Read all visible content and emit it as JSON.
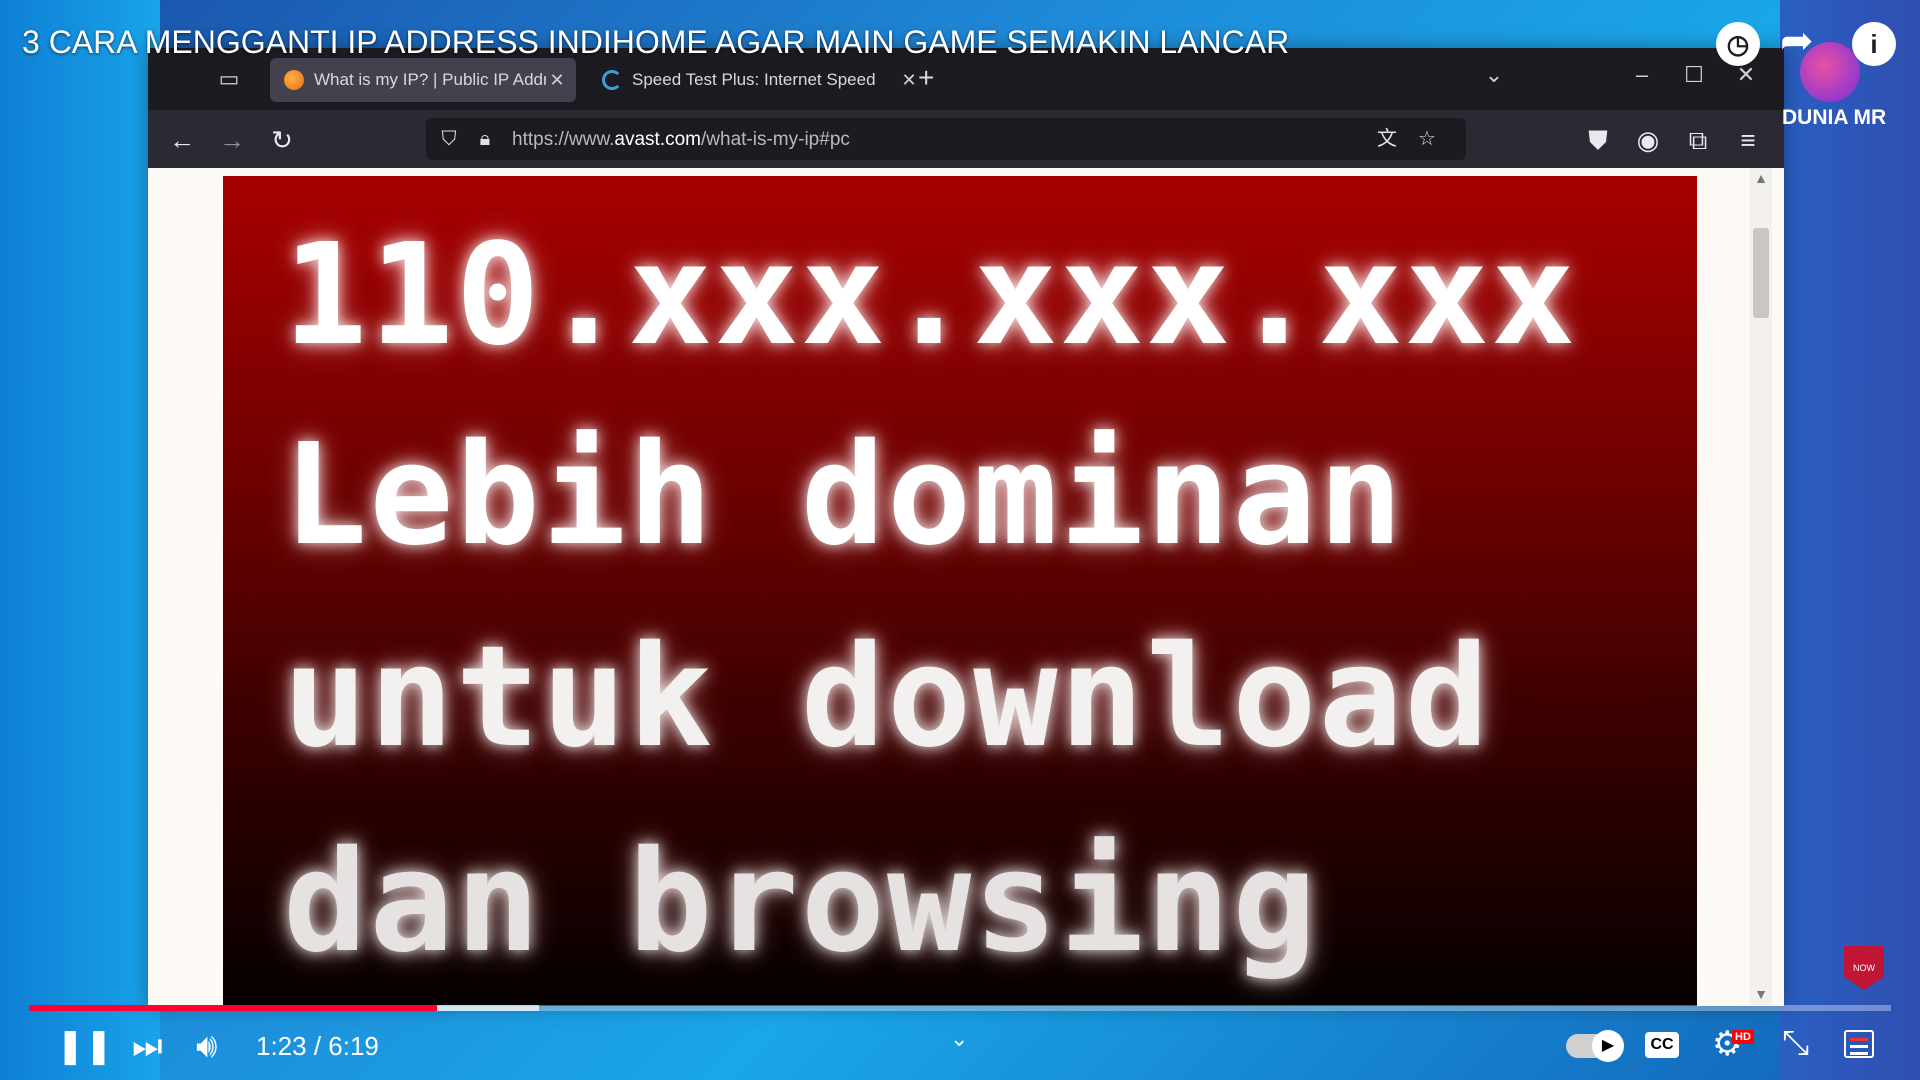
{
  "video": {
    "title": "3 CARA MENGGANTI IP ADDRESS INDIHOME AGAR MAIN GAME SEMAKIN LANCAR",
    "channel_name": "DUNIA MR",
    "current_time": "1:23",
    "duration": "6:19",
    "time_display": "1:23 / 6:19",
    "progress_played_fraction": 0.219,
    "progress_buffered_fraction": 0.274,
    "hd_badge": "HD",
    "cc_label": "CC",
    "subscribe_badge_text": "NOW"
  },
  "browser": {
    "tabs": [
      {
        "title": "What is my IP? | Public IP Addre",
        "active": true
      },
      {
        "title": "Speed Test Plus: Internet Speed",
        "active": false
      }
    ],
    "url_prefix": "https://www.",
    "url_host": "avast.com",
    "url_path": "/what-is-my-ip#pc"
  },
  "overlay": {
    "line1": "110.xxx.xxx.xxx",
    "line2": "Lebih dominan",
    "line3": "untuk download",
    "line4": "dan browsing"
  },
  "icons": {
    "watch_later": "clock-icon",
    "share": "share-icon",
    "info": "info-icon",
    "colors": {
      "progress_played": "#ff0033",
      "banner_top": "#a80000",
      "banner_bottom": "#050000"
    }
  }
}
